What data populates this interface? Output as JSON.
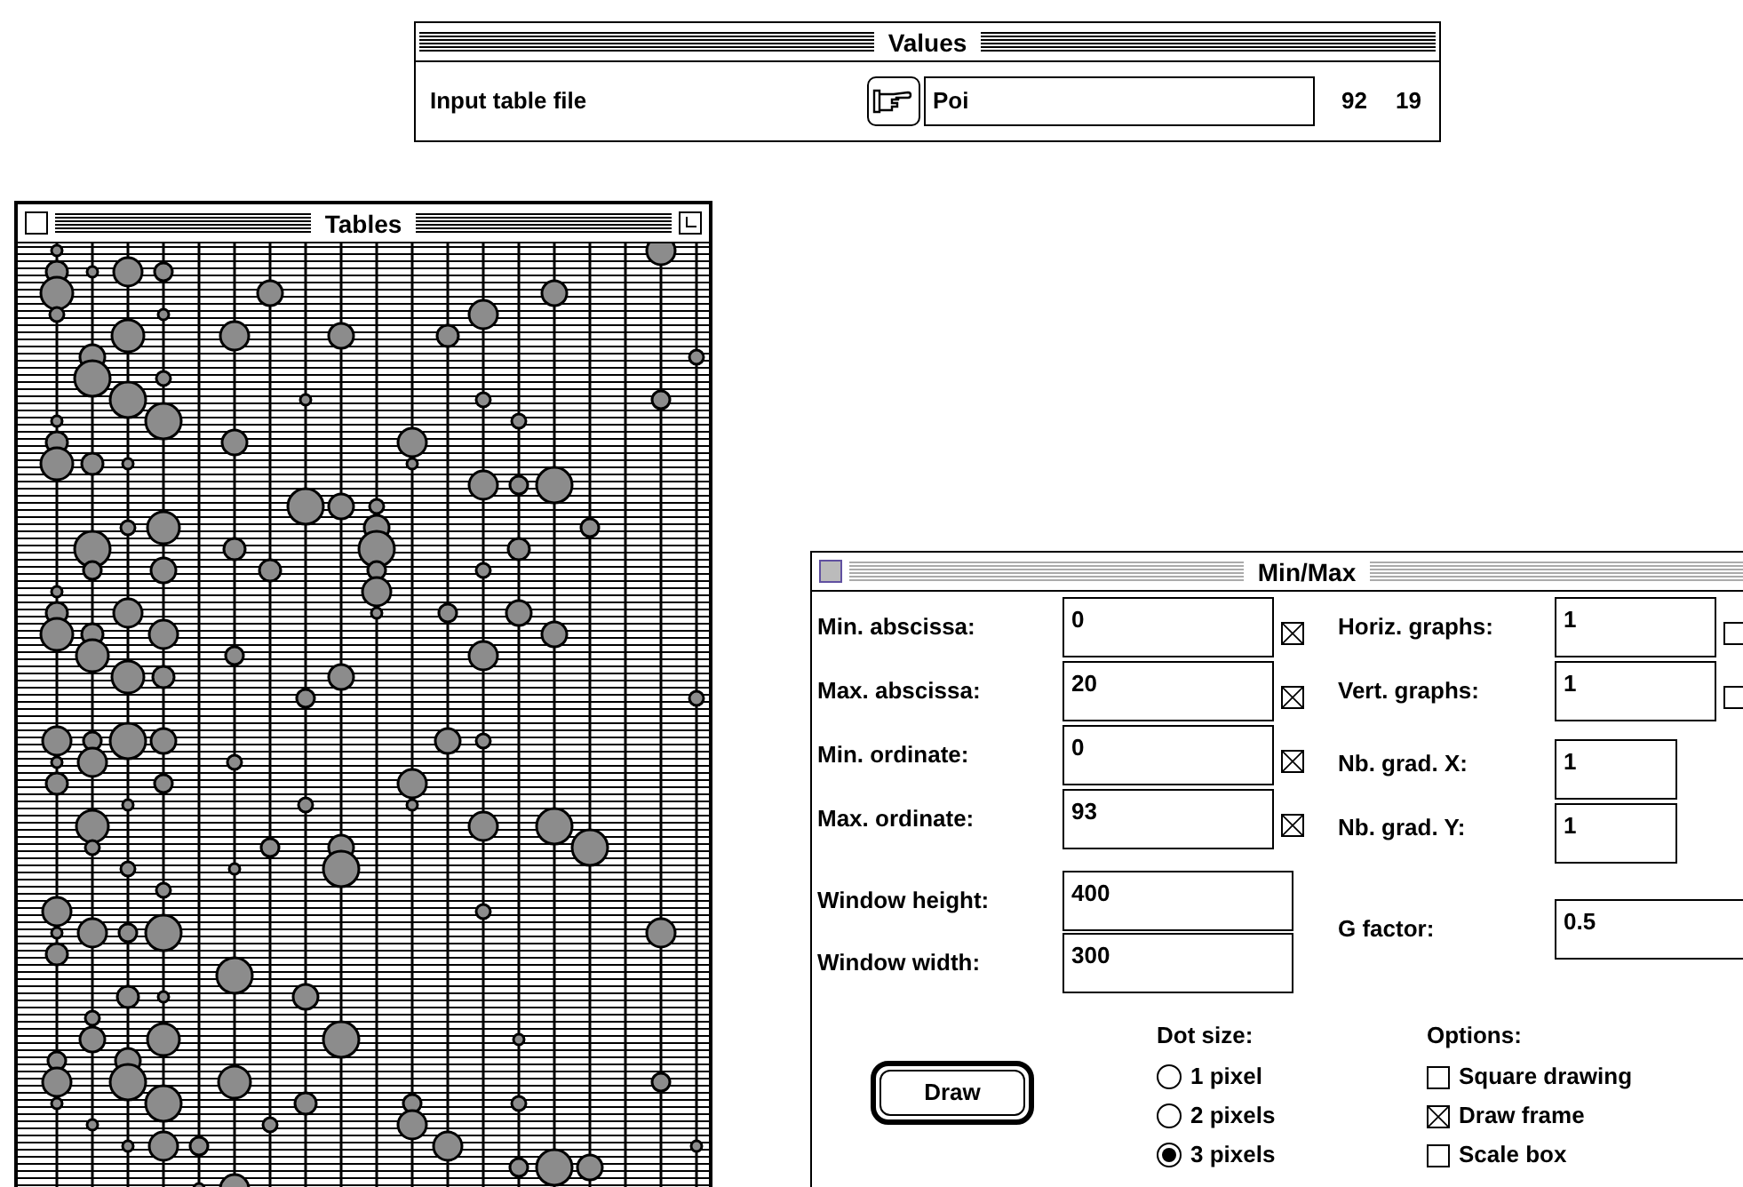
{
  "values_window": {
    "title": "Values",
    "rows": [
      {
        "label": "Input table file",
        "value": "Poi",
        "column_3": "92",
        "column_4": "19"
      }
    ]
  },
  "tables_window": {
    "title": "Tables"
  },
  "minmax_window": {
    "title": "Min/Max",
    "left_fields": [
      {
        "label": "Min. abscissa:",
        "value": "0",
        "checked": true
      },
      {
        "label": "Max. abscissa:",
        "value": "20",
        "checked": true
      },
      {
        "label": "Min. ordinate:",
        "value": "0",
        "checked": true
      },
      {
        "label": "Max. ordinate:",
        "value": "93",
        "checked": true
      }
    ],
    "right_fields": [
      {
        "label": "Horiz. graphs:",
        "value": "1",
        "kind": "checkbox",
        "checked": false
      },
      {
        "label": "Vert. graphs:",
        "value": "1",
        "kind": "checkbox",
        "checked": false
      },
      {
        "label": "Nb. grad. X:",
        "value": "1",
        "kind": "plain"
      },
      {
        "label": "Nb. grad. Y:",
        "value": "1",
        "kind": "plain"
      }
    ],
    "size_fields": [
      {
        "label": "Window height:",
        "value": "400"
      },
      {
        "label": "Window width:",
        "value": "300"
      }
    ],
    "g_factor": {
      "label": "G factor:",
      "value": "0.5"
    },
    "draw_button": "Draw",
    "dot_size": {
      "label": "Dot size:",
      "options": [
        {
          "label": "1 pixel",
          "selected": false
        },
        {
          "label": "2 pixels",
          "selected": false
        },
        {
          "label": "3 pixels",
          "selected": true
        }
      ]
    },
    "options": {
      "label": "Options:",
      "items": [
        {
          "label": "Square drawing",
          "checked": false
        },
        {
          "label": "Draw frame",
          "checked": true
        },
        {
          "label": "Scale box",
          "checked": false
        }
      ]
    }
  }
}
